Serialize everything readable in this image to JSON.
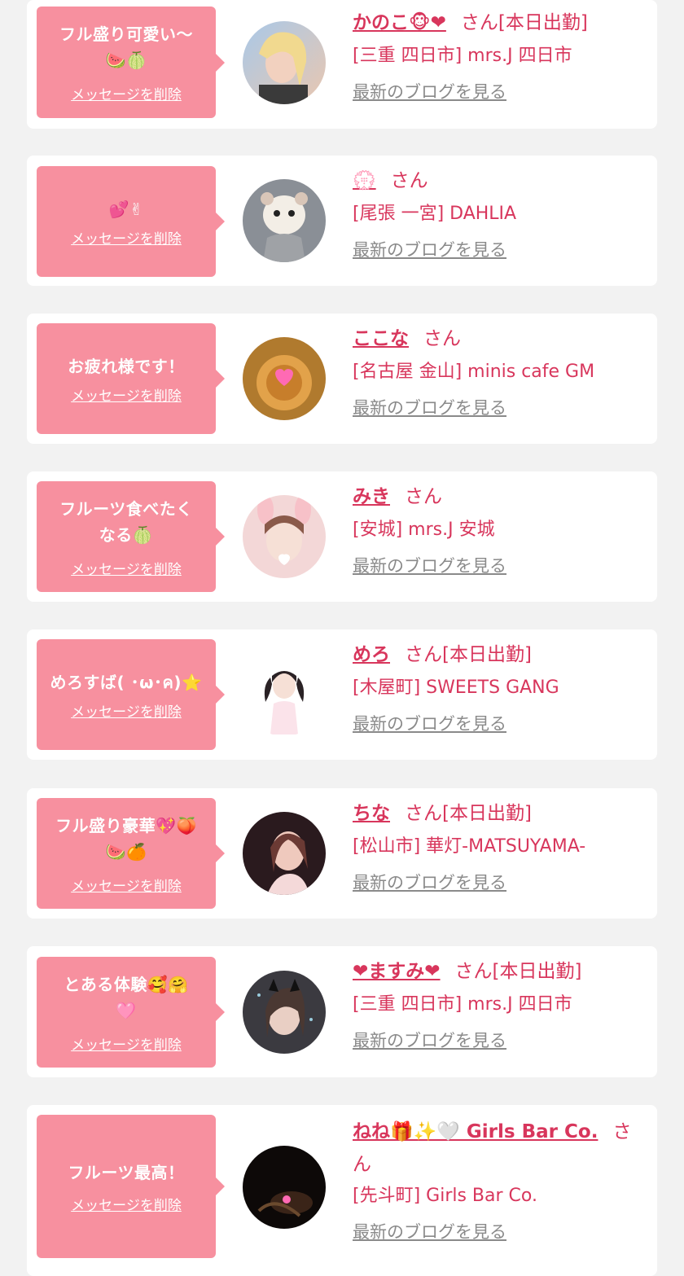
{
  "colors": {
    "accent": "#d8365c",
    "bubble": "#f7909f",
    "link_gray": "#8a8a8a",
    "background": "#f2f2f2"
  },
  "delete_label": "メッセージを削除",
  "blog_label": "最新のブログを見る",
  "items": [
    {
      "message_line1": "フル盛り可愛い〜",
      "message_line2": "🍉🍈",
      "name": "かのこ🐵❤",
      "san": "さん[本日出勤]",
      "shop": "[三重 四日市] mrs.J 四日市",
      "avatar_icon": "avatar-blonde-woman"
    },
    {
      "message_line1": "💕✌",
      "message_line2": "",
      "name": "💮",
      "san": "さん",
      "shop": "[尾張 一宮] DAHLIA",
      "avatar_icon": "avatar-hamster"
    },
    {
      "message_line1": "お疲れ様です！",
      "message_line2": "",
      "name": "ここな",
      "san": "さん",
      "shop": "[名古屋 金山] minis cafe GM",
      "avatar_icon": "avatar-cafe"
    },
    {
      "message_line1": "フルーツ食べたく",
      "message_line2": "なる🍈",
      "name": "みき",
      "san": "さん",
      "shop": "[安城] mrs.J 安城",
      "avatar_icon": "avatar-bunny-ears"
    },
    {
      "message_line1": "めろすば( ･ω･ค)⭐",
      "message_line2": "",
      "name": "めろ",
      "san": "さん[本日出勤]",
      "shop": "[木屋町] SWEETS GANG",
      "avatar_icon": "avatar-pigtails"
    },
    {
      "message_line1": "フル盛り豪華💖🍑",
      "message_line2": "🍉🍊",
      "name": "ちな",
      "san": "さん[本日出勤]",
      "shop": "[松山市] 華灯-MATSUYAMA-",
      "avatar_icon": "avatar-woman-dark"
    },
    {
      "message_line1": "とある体験🥰🤗",
      "message_line2": "🩷",
      "name": "❤ますみ❤",
      "san": "さん[本日出勤]",
      "shop": "[三重 四日市] mrs.J 四日市",
      "avatar_icon": "avatar-cat-filter"
    },
    {
      "message_line1": "フルーツ最高！",
      "message_line2": "",
      "name": "ねね🎁✨🤍 Girls Bar Co.",
      "san": "さん",
      "shop": "[先斗町] Girls Bar Co.",
      "avatar_icon": "avatar-night"
    }
  ]
}
